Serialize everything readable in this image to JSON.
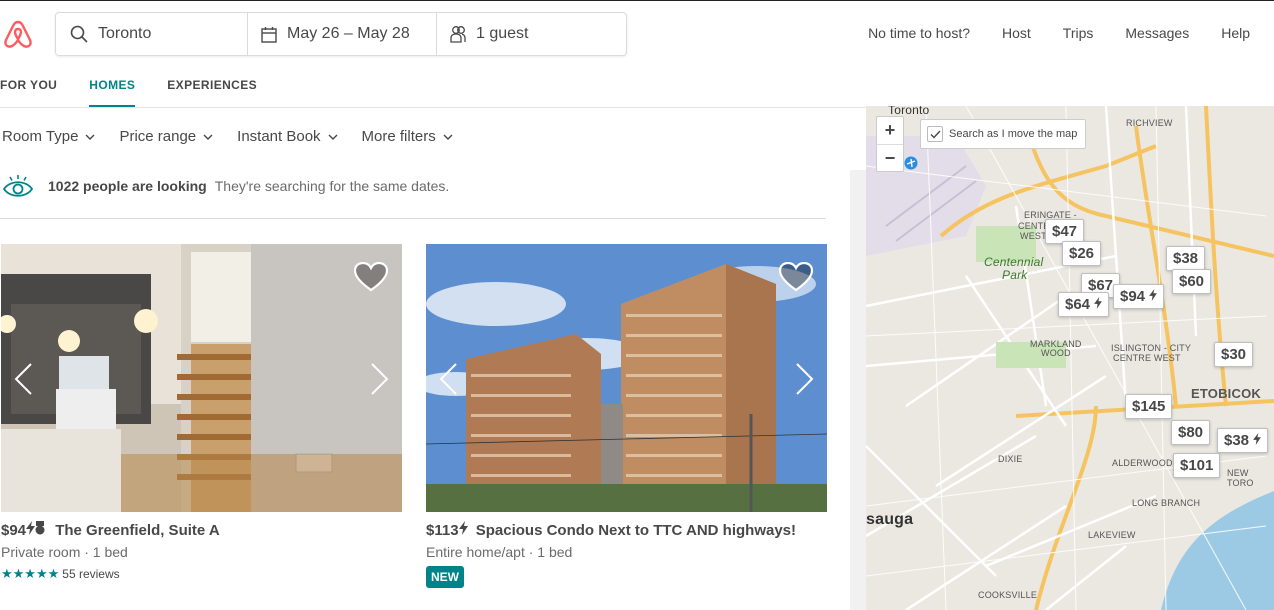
{
  "colors": {
    "brand": "#FF5A5F",
    "teal": "#008489",
    "text": "#484848"
  },
  "search": {
    "location": "Toronto",
    "dates": "May 26 – May 28",
    "guests": "1 guest"
  },
  "nav": {
    "no_time": "No time to host?",
    "host": "Host",
    "trips": "Trips",
    "messages": "Messages",
    "help": "Help"
  },
  "tabs": [
    "FOR YOU",
    "HOMES",
    "EXPERIENCES"
  ],
  "filters": [
    "Room Type",
    "Price range",
    "Instant Book",
    "More filters"
  ],
  "lookers": {
    "count": "1022 people are looking",
    "sub": "They're searching for the same dates."
  },
  "listings": [
    {
      "price": "$94",
      "title": "The Greenfield, Suite A",
      "kind": "Private room · 1 bed",
      "reviews": "55 reviews",
      "rating": 5
    },
    {
      "price": "$113",
      "title": "Spacious Condo Next to TTC AND highways!",
      "kind": "Entire home/apt · 1 bed",
      "badge": "NEW"
    }
  ],
  "map": {
    "search_move": "Search as I move the map",
    "zoom_in": "+",
    "zoom_out": "−",
    "labels": {
      "toronto": "Toronto",
      "richview": "RICHVIEW",
      "centennial": "Centennial",
      "park": "Park",
      "markland": "MARKLAND",
      "wood": "WOOD",
      "islington": "ISLINGTON - CITY",
      "centre_west": "CENTRE WEST",
      "etobicoke": "ETOBICOK",
      "dixie": "DIXIE",
      "alderwood": "ALDERWOOD",
      "new_toro": "NEW TORO",
      "long_branch": "LONG BRANCH",
      "lakeview": "LAKEVIEW",
      "sauga": "sauga",
      "cooksville": "COOKSVILLE",
      "erin1": "ERINGATE -",
      "erin2": "CENTE",
      "erin3": "WEST"
    },
    "pins": [
      "$47",
      "$26",
      "$38",
      "$67",
      "$60",
      "$64",
      "$94",
      "$30",
      "$145",
      "$80",
      "$38",
      "$101"
    ]
  }
}
